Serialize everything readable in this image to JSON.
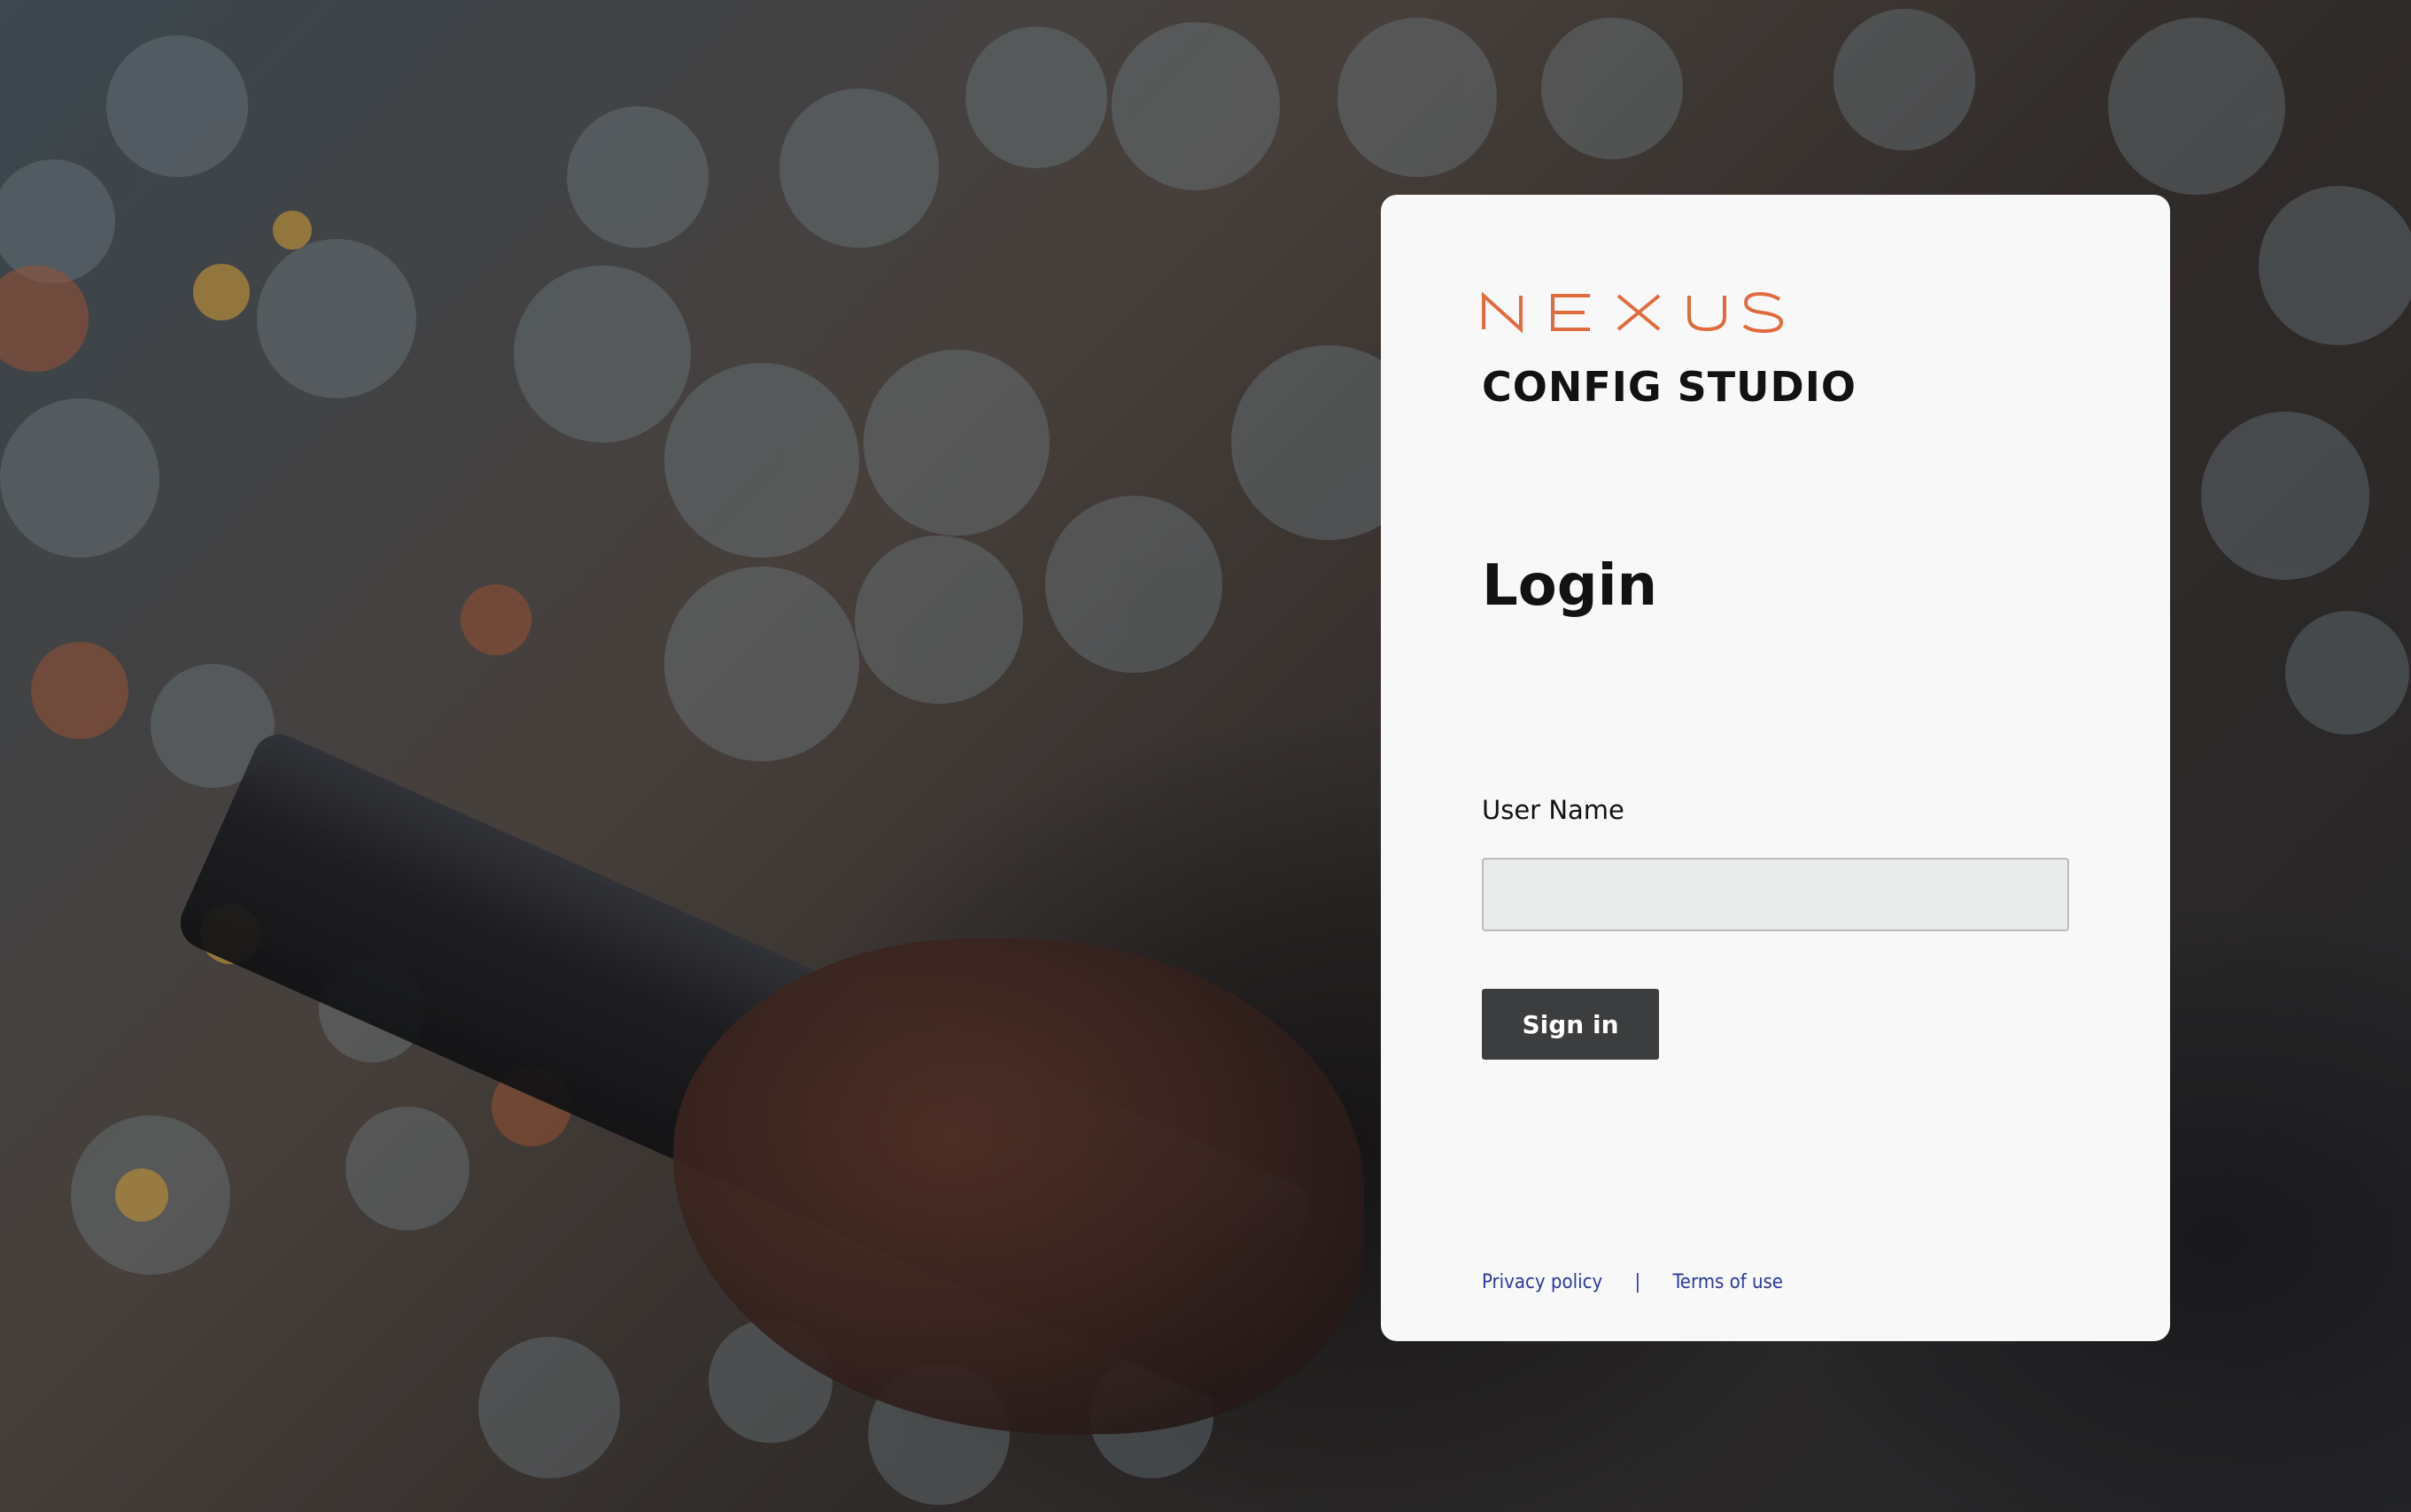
{
  "brand": {
    "logo_text": "NEXUS",
    "logo_color": "#e06b3f",
    "product_name": "CONFIG STUDIO"
  },
  "login": {
    "title": "Login",
    "username_label": "User Name",
    "username_value": "",
    "signin_label": "Sign in",
    "signin_bg": "#3b3d3f"
  },
  "footer": {
    "privacy_label": "Privacy policy",
    "separator": "|",
    "terms_label": "Terms of use",
    "link_color": "#2a3a9a"
  }
}
